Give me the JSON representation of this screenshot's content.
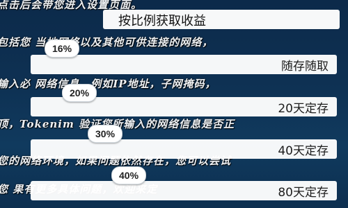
{
  "background_lines": [
    "点击后会带您进入设置页面。",
    "包括您 当地网络以及其他可供连接的网络，",
    "输入必 网络信息，例如IP地址，子网掩码，",
    "顶，Tokenim 验证您所输入的网络信息是否正",
    "您的网络环境，如果问题依然存在，您可以尝试",
    "您 果有更多具体问题，欢迎来定"
  ],
  "header_row": {
    "label": "按比例获取收益"
  },
  "rows": [
    {
      "badge": "16%",
      "label": "随存随取"
    },
    {
      "badge": "20%",
      "label": "20天定存"
    },
    {
      "badge": "30%",
      "label": "40天定存"
    },
    {
      "badge": "40%",
      "label": "80天定存"
    }
  ],
  "colors": {
    "background": "#0e3153",
    "row": "#ffffff",
    "text": "#1d1d1d"
  }
}
